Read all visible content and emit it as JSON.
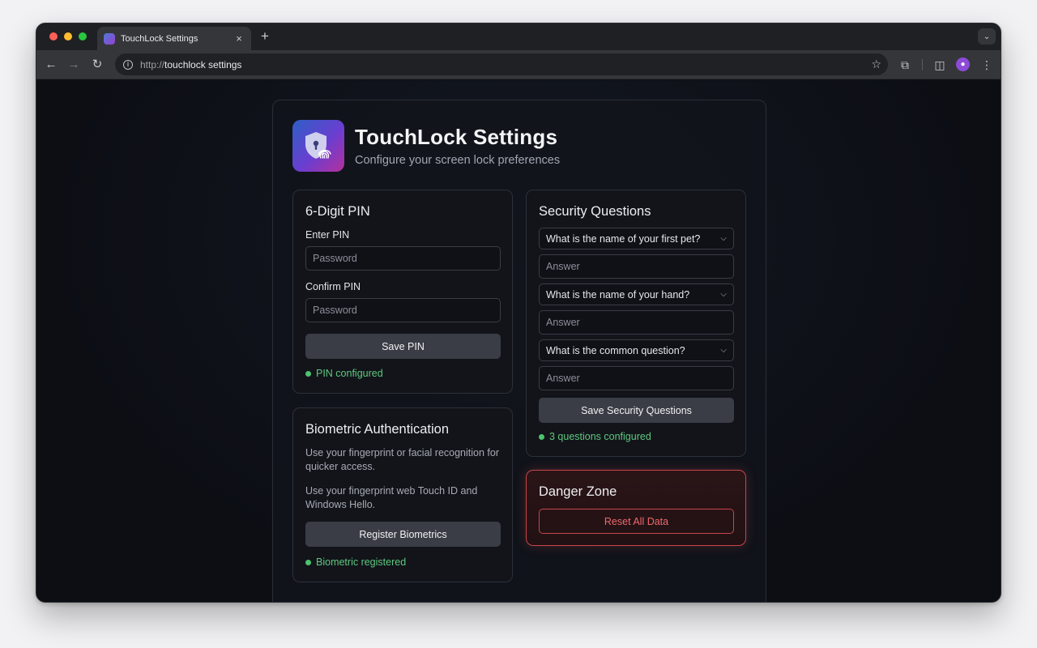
{
  "browser": {
    "tab_title": "TouchLock Settings",
    "tab_close": "×",
    "new_tab": "+",
    "url_scheme": "http://",
    "url_host": "touchlock settings"
  },
  "header": {
    "title": "TouchLock Settings",
    "subtitle": "Configure your screen lock preferences"
  },
  "pin": {
    "heading": "6-Digit PIN",
    "enter_label": "Enter PIN",
    "enter_placeholder": "Password",
    "confirm_label": "Confirm PIN",
    "confirm_placeholder": "Password",
    "save_label": "Save PIN",
    "status": "PIN configured"
  },
  "biometric": {
    "heading": "Biometric Authentication",
    "desc1": "Use your fingerprint or facial recognition for quicker access.",
    "desc2": "Use your fingerprint web Touch ID and Windows Hello.",
    "register_label": "Register Biometrics",
    "status": "Biometric registered"
  },
  "security": {
    "heading": "Security Questions",
    "questions": [
      {
        "question": "What is the name of your first pet?",
        "answer_placeholder": "Answer"
      },
      {
        "question": "What is the name of your hand?",
        "answer_placeholder": "Answer"
      },
      {
        "question": "What is the common question?",
        "answer_placeholder": "Answer"
      }
    ],
    "save_label": "Save Security Questions",
    "status": "3 questions configured"
  },
  "danger": {
    "heading": "Danger Zone",
    "reset_label": "Reset All Data"
  },
  "colors": {
    "success": "#4cc36f",
    "danger": "#c7464a",
    "accent_gradient_start": "#2e5fc6",
    "accent_gradient_end": "#b5309c"
  }
}
